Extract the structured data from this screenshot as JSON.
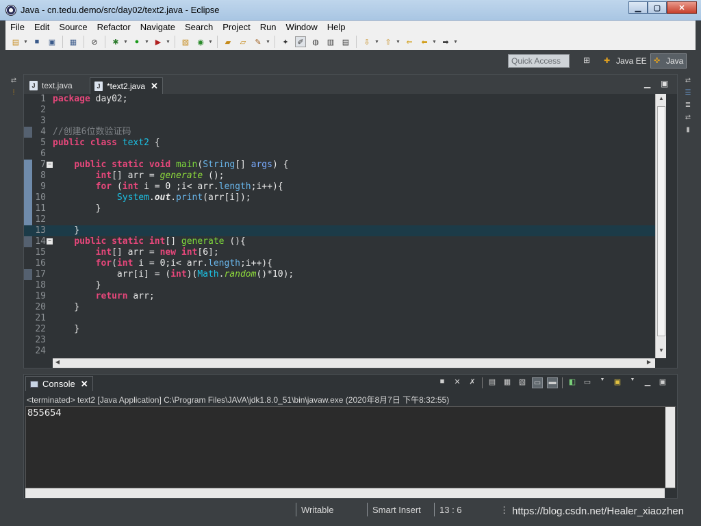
{
  "window": {
    "title": "Java - cn.tedu.demo/src/day02/text2.java - Eclipse",
    "minimize": "▁",
    "maximize": "▢",
    "close": "✕"
  },
  "menu": [
    "File",
    "Edit",
    "Source",
    "Refactor",
    "Navigate",
    "Search",
    "Project",
    "Run",
    "Window",
    "Help"
  ],
  "perspective": {
    "quick_access_placeholder": "Quick Access",
    "java_ee": "Java EE",
    "java": "Java"
  },
  "editor": {
    "tabs": [
      {
        "label": "text.java",
        "active": false
      },
      {
        "label": "*text2.java",
        "active": true
      }
    ],
    "current_line": 13,
    "line_numbers": [
      "1",
      "2",
      "3",
      "4",
      "5",
      "6",
      "7",
      "8",
      "9",
      "10",
      "11",
      "12",
      "13",
      "14",
      "15",
      "16",
      "17",
      "18",
      "19",
      "20",
      "21",
      "22",
      "23",
      "24"
    ]
  },
  "console": {
    "tab_label": "Console",
    "status": "<terminated> text2 [Java Application] C:\\Program Files\\JAVA\\jdk1.8.0_51\\bin\\javaw.exe (2020年8月7日 下午8:32:55)",
    "output": "855654"
  },
  "statusbar": {
    "writable": "Writable",
    "insert_mode": "Smart Insert",
    "position": "13 : 6"
  },
  "watermark": "https://blog.csdn.net/Healer_xiaozhen",
  "colors": {
    "keyword": "#e7477b",
    "type": "#68b4e8",
    "method": "#7fda3c",
    "comment": "#7d8185",
    "current_line": "#1c3b48"
  }
}
